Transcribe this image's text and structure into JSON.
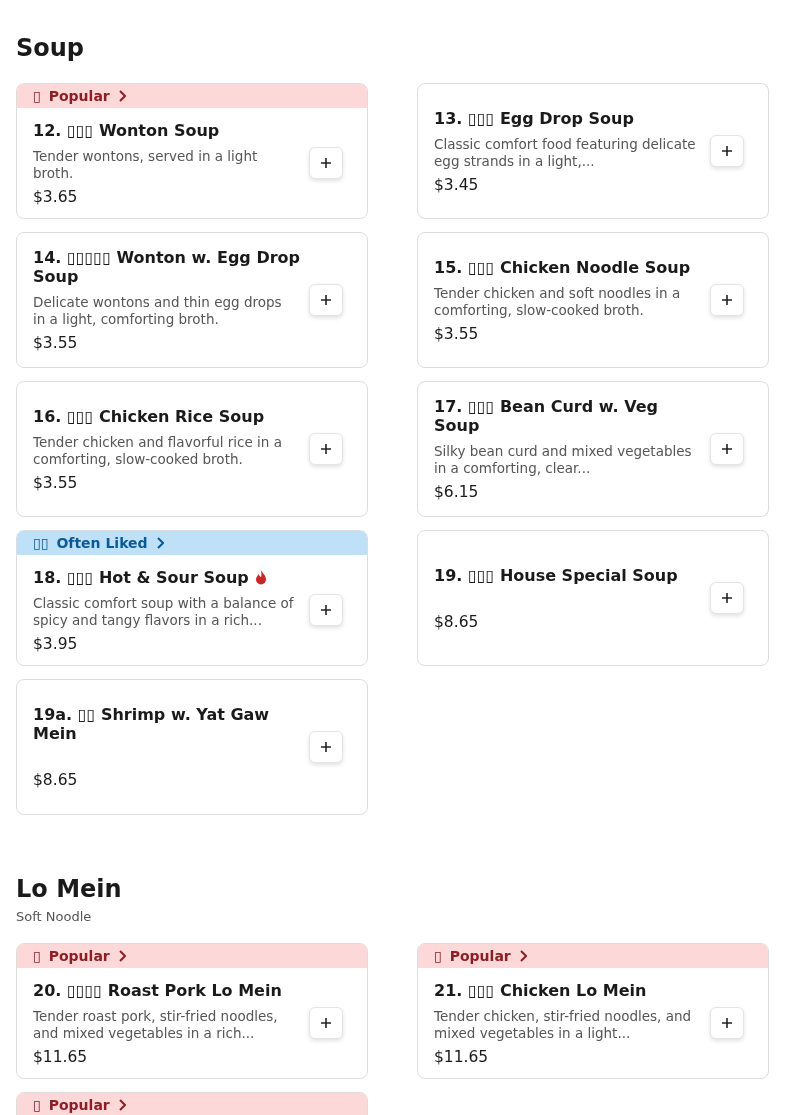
{
  "sections": [
    {
      "title": "Soup",
      "items": [
        {
          "badge": {
            "kind": "popular",
            "icon": "▯",
            "label": "Popular"
          },
          "name": "12. ▯▯▯ Wonton Soup",
          "spicy": false,
          "description": "Tender wontons, served in a light broth.",
          "price": "$3.65"
        },
        {
          "name": "13. ▯▯▯ Egg Drop Soup",
          "spicy": false,
          "description": "Classic comfort food featuring delicate egg strands in a light,...",
          "price": "$3.45"
        },
        {
          "name": "14. ▯▯▯▯▯ Wonton w. Egg Drop Soup",
          "spicy": false,
          "description": "Delicate wontons and thin egg drops in a light, comforting broth.",
          "price": "$3.55"
        },
        {
          "name": "15. ▯▯▯ Chicken Noodle Soup",
          "spicy": false,
          "description": "Tender chicken and soft noodles in a comforting, slow-cooked broth.",
          "price": "$3.55"
        },
        {
          "name": "16. ▯▯▯ Chicken Rice Soup",
          "spicy": false,
          "description": "Tender chicken and flavorful rice in a comforting, slow-cooked broth.",
          "price": "$3.55"
        },
        {
          "name": "17. ▯▯▯ Bean Curd w. Veg Soup",
          "spicy": false,
          "description": "Silky bean curd and mixed vegetables in a comforting, clear...",
          "price": "$6.15"
        },
        {
          "badge": {
            "kind": "liked",
            "icon": "▯▯",
            "label": "Often Liked"
          },
          "name": "18. ▯▯▯ Hot & Sour Soup",
          "spicy": true,
          "description": "Classic comfort soup with a balance of spicy and tangy flavors in a rich...",
          "price": "$3.95"
        },
        {
          "name": "19. ▯▯▯ House Special Soup",
          "spicy": false,
          "price": "$8.65"
        },
        {
          "name": "19a. ▯▯ Shrimp w. Yat Gaw Mein",
          "spicy": false,
          "price": "$8.65"
        }
      ]
    },
    {
      "title": "Lo Mein",
      "subtitle": "Soft Noodle",
      "items": [
        {
          "badge": {
            "kind": "popular",
            "icon": "▯",
            "label": "Popular"
          },
          "name": "20. ▯▯▯▯ Roast Pork Lo Mein",
          "spicy": false,
          "description": "Tender roast pork, stir-fried noodles, and mixed vegetables in a rich...",
          "price": "$11.65"
        },
        {
          "badge": {
            "kind": "popular",
            "icon": "▯",
            "label": "Popular"
          },
          "name": "21. ▯▯▯ Chicken Lo Mein",
          "spicy": false,
          "description": "Tender chicken, stir-fried noodles, and mixed vegetables in a light...",
          "price": "$11.65"
        },
        {
          "badge": {
            "kind": "popular",
            "icon": "▯",
            "label": "Popular"
          }
        }
      ]
    }
  ]
}
